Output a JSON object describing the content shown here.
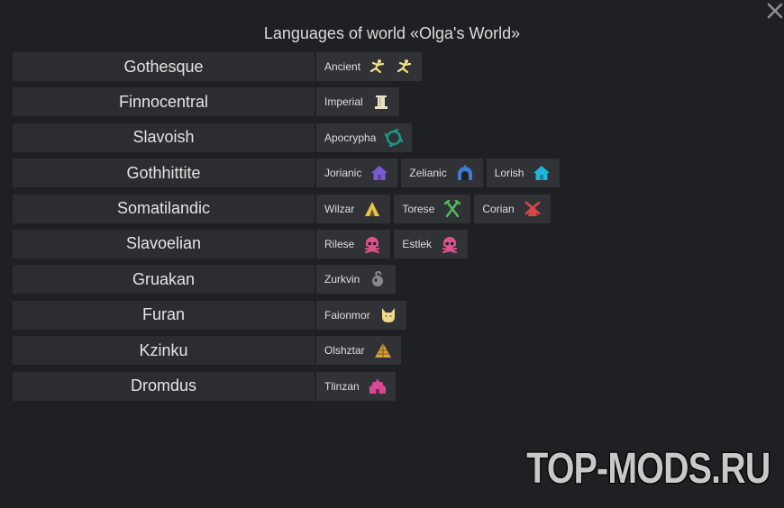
{
  "title": "Languages of world «Olga's World»",
  "close_icon": "close-icon",
  "watermark": "TOP-MODS.RU",
  "families": [
    {
      "name": "Gothesque",
      "languages": [
        {
          "name": "Ancient",
          "icon": "dancers-icon",
          "color": "#f3e28a"
        }
      ]
    },
    {
      "name": "Finnocentral",
      "languages": [
        {
          "name": "Imperial",
          "icon": "pillar-icon",
          "color": "#e8e2c4"
        }
      ]
    },
    {
      "name": "Slavoish",
      "languages": [
        {
          "name": "Apocrypha",
          "icon": "swirl-icon",
          "color": "#1f9a86"
        }
      ]
    },
    {
      "name": "Gothhittite",
      "languages": [
        {
          "name": "Jorianic",
          "icon": "house-icon",
          "color": "#7a5bd0"
        },
        {
          "name": "Zelianic",
          "icon": "dome-icon",
          "color": "#3f7bd6"
        },
        {
          "name": "Lorish",
          "icon": "house-icon",
          "color": "#1fb5d6"
        }
      ]
    },
    {
      "name": "Somatilandic",
      "languages": [
        {
          "name": "Wilzar",
          "icon": "tent-icon",
          "color": "#e8c24a"
        },
        {
          "name": "Torese",
          "icon": "tools-icon",
          "color": "#4fbf5a"
        },
        {
          "name": "Corian",
          "icon": "windmill-icon",
          "color": "#d94848"
        }
      ]
    },
    {
      "name": "Slavoelian",
      "languages": [
        {
          "name": "Rilese",
          "icon": "skull-icon",
          "color": "#e0508e"
        },
        {
          "name": "Estlek",
          "icon": "skull-icon",
          "color": "#e0508e"
        }
      ]
    },
    {
      "name": "Gruakan",
      "languages": [
        {
          "name": "Zurkvin",
          "icon": "bomb-icon",
          "color": "#8a8a8a"
        }
      ]
    },
    {
      "name": "Furan",
      "languages": [
        {
          "name": "Faionmor",
          "icon": "cat-icon",
          "color": "#f0d98c"
        }
      ]
    },
    {
      "name": "Kzinku",
      "languages": [
        {
          "name": "Olshztar",
          "icon": "pyramid-icon",
          "color": "#d9a03a"
        }
      ]
    },
    {
      "name": "Dromdus",
      "languages": [
        {
          "name": "Tlinzan",
          "icon": "temple-icon",
          "color": "#d94896"
        }
      ]
    }
  ]
}
